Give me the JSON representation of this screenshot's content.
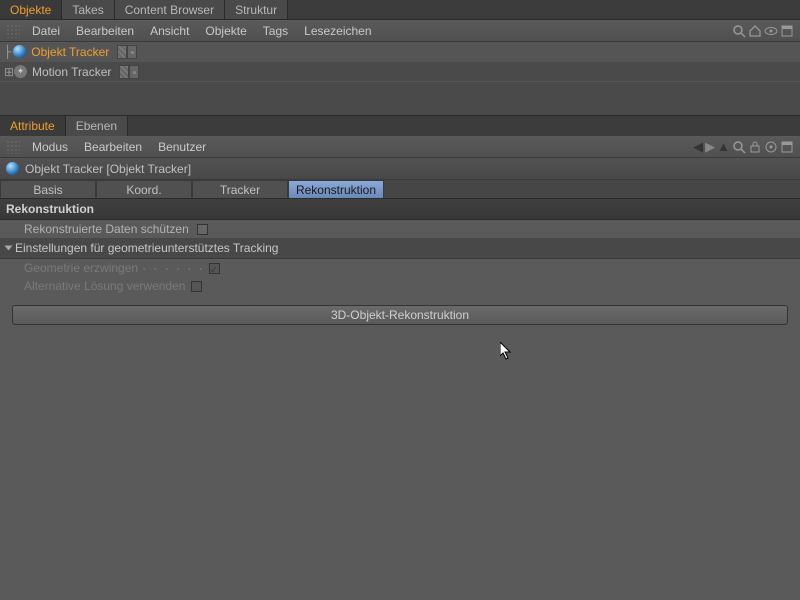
{
  "top_tabs": {
    "objekte": "Objekte",
    "takes": "Takes",
    "content": "Content Browser",
    "struktur": "Struktur"
  },
  "menubar": {
    "datei": "Datei",
    "bearbeiten": "Bearbeiten",
    "ansicht": "Ansicht",
    "objekte": "Objekte",
    "tags": "Tags",
    "lesezeichen": "Lesezeichen"
  },
  "tree": {
    "item1": "Objekt Tracker",
    "item2": "Motion Tracker"
  },
  "lower_tabs": {
    "attribute": "Attribute",
    "ebenen": "Ebenen"
  },
  "attr_menu": {
    "modus": "Modus",
    "bearbeiten": "Bearbeiten",
    "benutzer": "Benutzer"
  },
  "obj_header": "Objekt Tracker [Objekt Tracker]",
  "prop_tabs": {
    "basis": "Basis",
    "koord": "Koord.",
    "tracker": "Tracker",
    "rekon": "Rekonstruktion"
  },
  "section": "Rekonstruktion",
  "protect_label": "Rekonstruierte Daten schützen",
  "geo_section": "Einstellungen für geometrieunterstütztes Tracking",
  "force_geo": "Geometrie erzwingen",
  "alt_sol": "Alternative Lösung verwenden",
  "reconstruct_btn": "3D-Objekt-Rekonstruktion"
}
